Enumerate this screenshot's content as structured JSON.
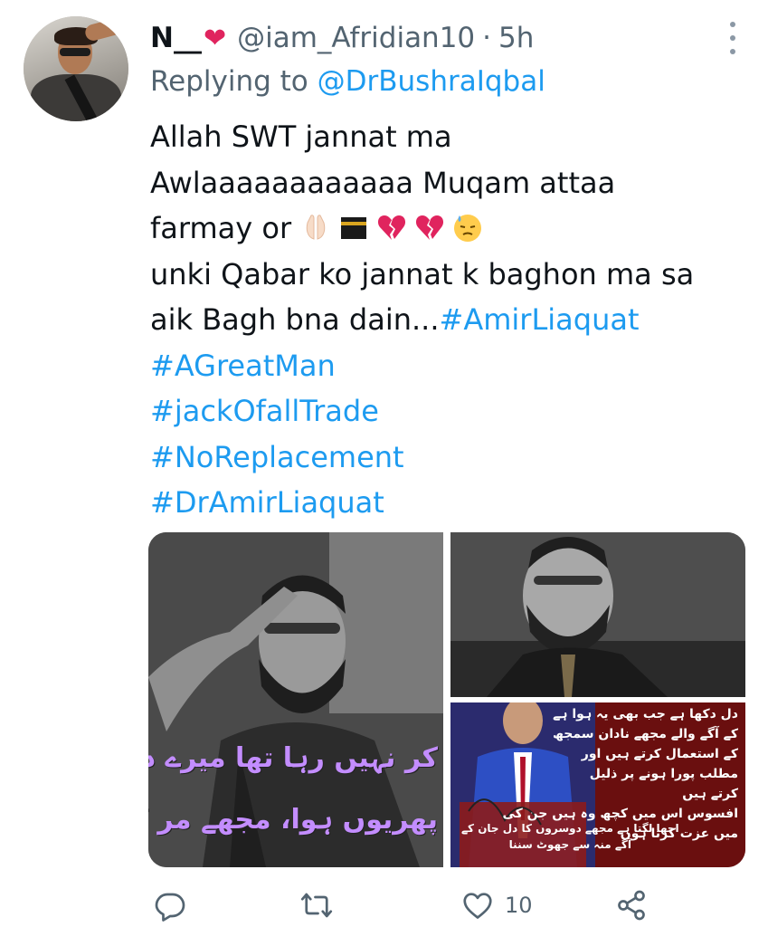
{
  "tweet": {
    "display_name": "N__",
    "display_name_emoji": "heart-emoji",
    "handle": "@iam_Afridian10",
    "separator": "·",
    "time": "5h",
    "replying_prefix": "Replying to",
    "replying_to": "@DrBushraIqbal",
    "text_lines": {
      "l1": "Allah SWT  jannat ma",
      "l2": "Awlaaaaaaaaaaaa Muqam attaa",
      "l3": "farmay or",
      "l4": "unki Qabar ko jannat k baghon ma sa",
      "l5": "aik Bagh bna dain..."
    },
    "emojis": [
      "folded-hands-emoji",
      "kaaba-emoji",
      "broken-heart-emoji",
      "broken-heart-emoji",
      "downcast-sweat-emoji"
    ],
    "hashtags": [
      "#AmirLiaquat",
      "#AGreatMan",
      "#jackOfallTrade",
      "#NoReplacement",
      "#DrAmirLiaquat"
    ],
    "media": {
      "image1_caption_line1": "کر نہیں رہا تھا میرے درد کا یہ",
      "image1_caption_line2": "پھریوں ہوا، مجھے مر کر دکھانا پڑا",
      "image3_text_right": [
        "دل دکھا ہے جب بھی یہ ہوا ہے",
        "کے آگے والے مجھے نادان سمجھ",
        "کے استعمال کرتے ہیں اور",
        "مطلب پورا ہونے پر ذلیل",
        "کرتے ہیں",
        "افسوس اس میں کچھ وہ ہیں جن کی",
        "میں عزت کرتا ہوں"
      ],
      "image3_text_left": [
        "اچھا لگتا ہے مجھے دوسروں کا دل جان کے",
        "آگے منہ سے جھوٹ سننا"
      ]
    },
    "actions": {
      "like_count": "10"
    },
    "colors": {
      "link": "#1d9bf0",
      "secondary_text": "#536471",
      "heart": "#e0245e"
    }
  }
}
